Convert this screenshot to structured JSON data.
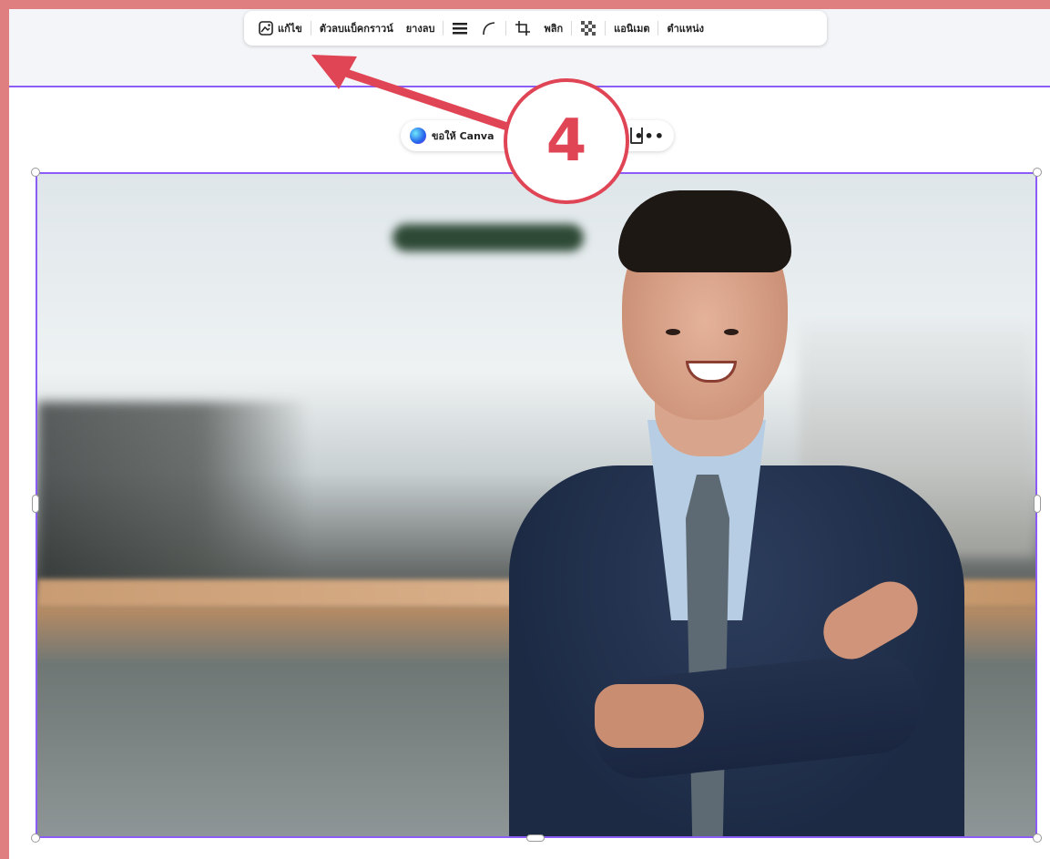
{
  "toolbar": {
    "edit_label": "แก้ไข",
    "bg_remover_label": "ตัวลบแบ็คกราวน์",
    "eraser_label": "ยางลบ",
    "flip_label": "พลิก",
    "animate_label": "แอนิเมต",
    "position_label": "ตำแหน่ง"
  },
  "float_bar": {
    "ask_canva_label": "ขอให้ Canva",
    "more_label": "•••"
  },
  "annotation": {
    "step_number": "4",
    "color": "#e04556"
  },
  "colors": {
    "selection": "#8b5cf6",
    "page_border": "#e07f7f"
  },
  "icons": {
    "edit": "image-edit-icon",
    "border_weight": "border-weight-icon",
    "corner_radius": "corner-radius-icon",
    "crop": "crop-icon",
    "transparency": "transparency-checker-icon",
    "more": "more-dots-icon"
  }
}
